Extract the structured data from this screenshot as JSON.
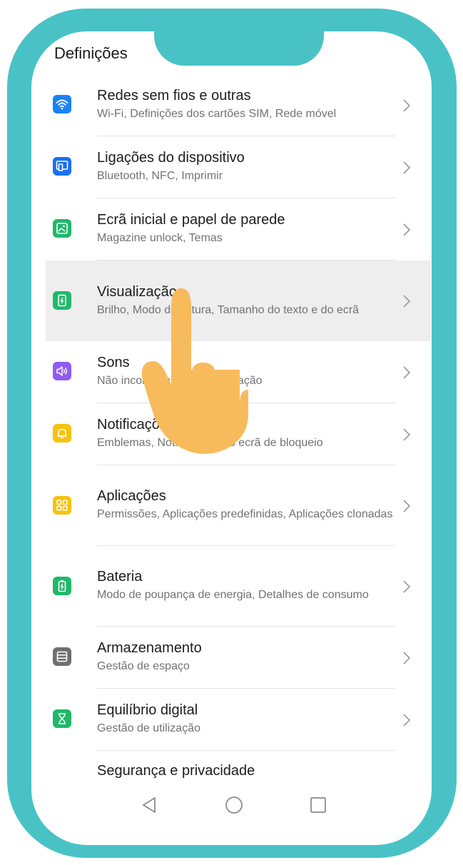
{
  "header": {
    "title": "Definições"
  },
  "settings": [
    {
      "title": "Redes sem fios e outras",
      "subtitle": "Wi-Fi, Definições dos cartões SIM, Rede móvel",
      "icon": "wifi-icon",
      "color": "#1a82f7"
    },
    {
      "title": "Ligações do dispositivo",
      "subtitle": "Bluetooth, NFC, Imprimir",
      "icon": "device-connection-icon",
      "color": "#1a6ff2"
    },
    {
      "title": "Ecrã inicial e papel de parede",
      "subtitle": "Magazine unlock, Temas",
      "icon": "wallpaper-icon",
      "color": "#21b86a"
    },
    {
      "title": "Visualização",
      "subtitle": "Brilho, Modo de leitura, Tamanho do texto e do ecrã",
      "icon": "display-icon",
      "color": "#21b86a"
    },
    {
      "title": "Sons",
      "subtitle": "Não incomodar, Toque, Vibração",
      "icon": "sound-icon",
      "color": "#8f5cf0"
    },
    {
      "title": "Notificações",
      "subtitle": "Emblemas, Notificações no ecrã de bloqueio",
      "icon": "notification-bell-icon",
      "color": "#f7c20e"
    },
    {
      "title": "Aplicações",
      "subtitle": "Permissões, Aplicações predefinidas, Aplicações clonadas",
      "icon": "apps-grid-icon",
      "color": "#f7c20e"
    },
    {
      "title": "Bateria",
      "subtitle": "Modo de poupança de energia, Detalhes de consumo",
      "icon": "battery-icon",
      "color": "#21b86a"
    },
    {
      "title": "Armazenamento",
      "subtitle": "Gestão de espaço",
      "icon": "storage-icon",
      "color": "#707070"
    },
    {
      "title": "Equilíbrio digital",
      "subtitle": "Gestão de utilização",
      "icon": "hourglass-icon",
      "color": "#21b86a"
    },
    {
      "title": "Segurança e privacidade",
      "subtitle": "",
      "icon": "",
      "color": ""
    }
  ],
  "colors": {
    "frame": "#49c2c6",
    "hand": "#f8bb5c",
    "highlight": "#eeeeee"
  },
  "navigation": {
    "back": "back-icon",
    "home": "home-icon",
    "recents": "recents-icon"
  }
}
